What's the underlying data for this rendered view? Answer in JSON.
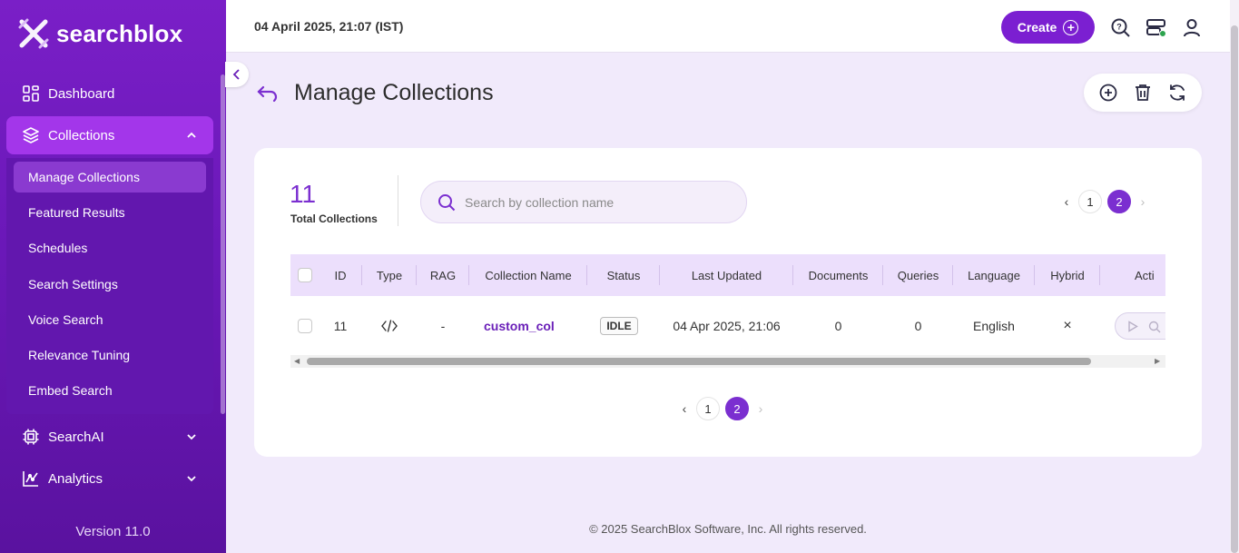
{
  "app": {
    "logo_text": "searchblox",
    "version": "Version 11.0"
  },
  "sidebar": {
    "items": [
      {
        "label": "Dashboard",
        "icon": "grid-icon"
      },
      {
        "label": "Collections",
        "icon": "layers-icon"
      },
      {
        "label": "SearchAI",
        "icon": "chip-icon"
      },
      {
        "label": "Analytics",
        "icon": "chart-icon"
      }
    ],
    "sub_items": [
      {
        "label": "Manage Collections"
      },
      {
        "label": "Featured Results"
      },
      {
        "label": "Schedules"
      },
      {
        "label": "Search Settings"
      },
      {
        "label": "Voice Search"
      },
      {
        "label": "Relevance Tuning"
      },
      {
        "label": "Embed Search"
      }
    ]
  },
  "topbar": {
    "datetime": "04 April 2025, 21:07 (IST)",
    "create_label": "Create"
  },
  "page": {
    "title": "Manage Collections"
  },
  "summary": {
    "total": "11",
    "total_label": "Total Collections"
  },
  "search": {
    "placeholder": "Search by collection name",
    "value": ""
  },
  "pagination": {
    "pages": [
      "1",
      "2"
    ],
    "current": "2"
  },
  "table": {
    "columns": [
      "ID",
      "Type",
      "RAG",
      "Collection Name",
      "Status",
      "Last Updated",
      "Documents",
      "Queries",
      "Language",
      "Hybrid",
      "Acti"
    ],
    "rows": [
      {
        "id": "11",
        "type": "</>",
        "rag": "-",
        "name": "custom_col",
        "status": "IDLE",
        "last_updated": "04 Apr 2025, 21:06",
        "documents": "0",
        "queries": "0",
        "language": "English",
        "hybrid": "×"
      }
    ]
  },
  "footer": {
    "text": "© 2025 SearchBlox Software, Inc. All rights reserved."
  },
  "colors": {
    "brand": "#7b1fd1",
    "sidebar": "#6a18b8",
    "accent": "#7b2fd0"
  }
}
